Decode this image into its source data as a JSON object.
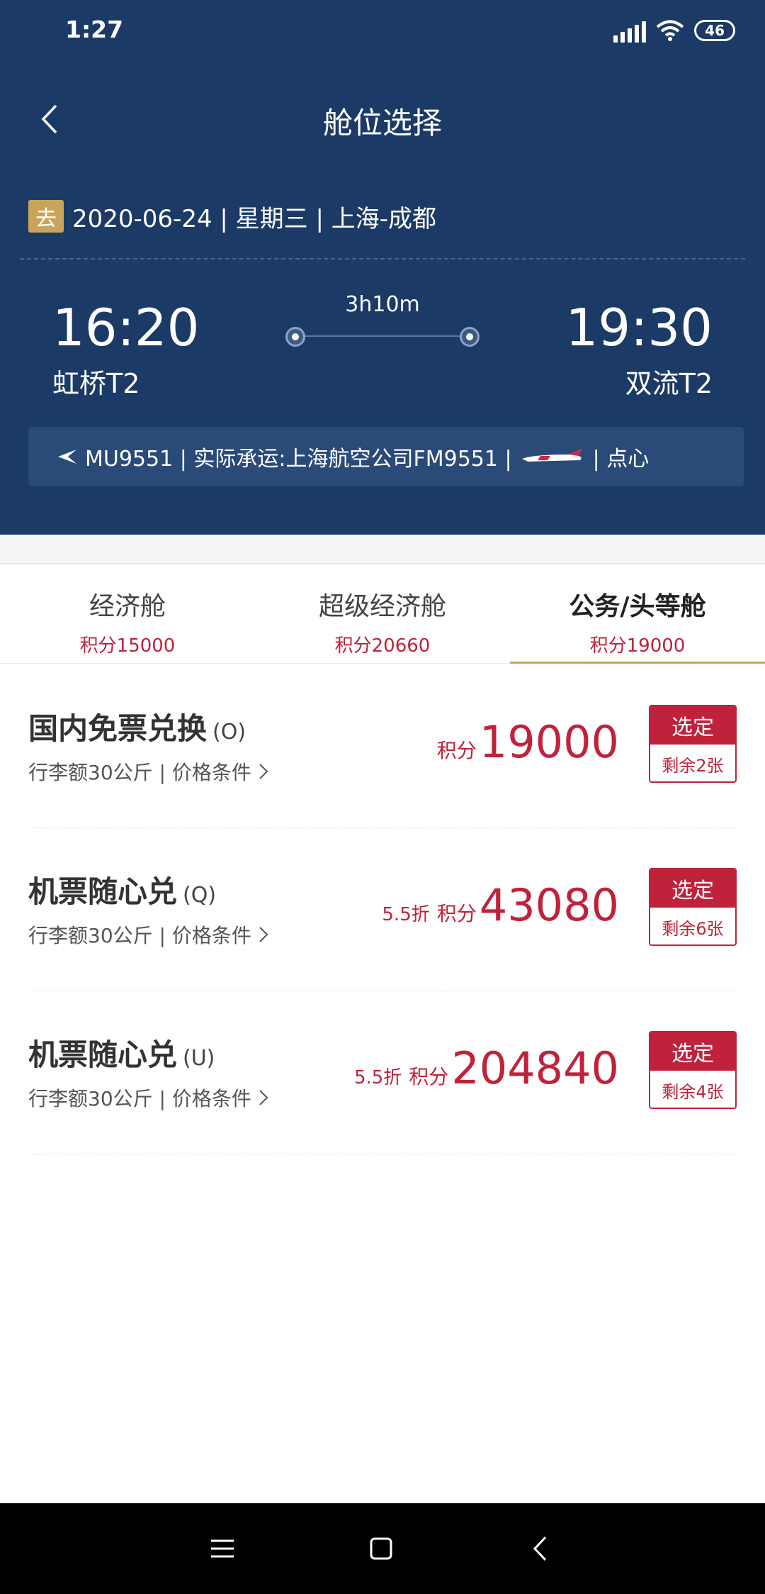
{
  "status_bar": {
    "time": "1:27",
    "battery": "46"
  },
  "nav": {
    "title": "舱位选择"
  },
  "trip": {
    "tag": "去",
    "info": "2020-06-24 | 星期三 | 上海-成都",
    "duration": "3h10m",
    "departure": {
      "time": "16:20",
      "airport": "虹桥T2"
    },
    "arrival": {
      "time": "19:30",
      "airport": "双流T2"
    },
    "flight_prefix": "MU9551 | 实际承运:上海航空公司FM9551 |",
    "flight_suffix": "| 点心"
  },
  "tabs": [
    {
      "name": "经济舱",
      "points": "积分15000",
      "active": false
    },
    {
      "name": "超级经济舱",
      "points": "积分20660",
      "active": false
    },
    {
      "name": "公务/头等舱",
      "points": "积分19000",
      "active": true
    }
  ],
  "fares": [
    {
      "name": "国内免票兑换",
      "code": "(O)",
      "condition": "行李额30公斤 | 价格条件",
      "discount": "",
      "points_label": "积分",
      "points": "19000",
      "select_label": "选定",
      "remaining": "剩余2张"
    },
    {
      "name": "机票随心兑",
      "code": "(Q)",
      "condition": "行李额30公斤 | 价格条件",
      "discount": "5.5折",
      "points_label": "积分",
      "points": "43080",
      "select_label": "选定",
      "remaining": "剩余6张"
    },
    {
      "name": "机票随心兑",
      "code": "(U)",
      "condition": "行李额30公斤 | 价格条件",
      "discount": "5.5折",
      "points_label": "积分",
      "points": "204840",
      "select_label": "选定",
      "remaining": "剩余4张"
    }
  ],
  "colors": {
    "header_bg": "#1c3a66",
    "accent_red": "#c0223b",
    "gold": "#c9a45a"
  }
}
